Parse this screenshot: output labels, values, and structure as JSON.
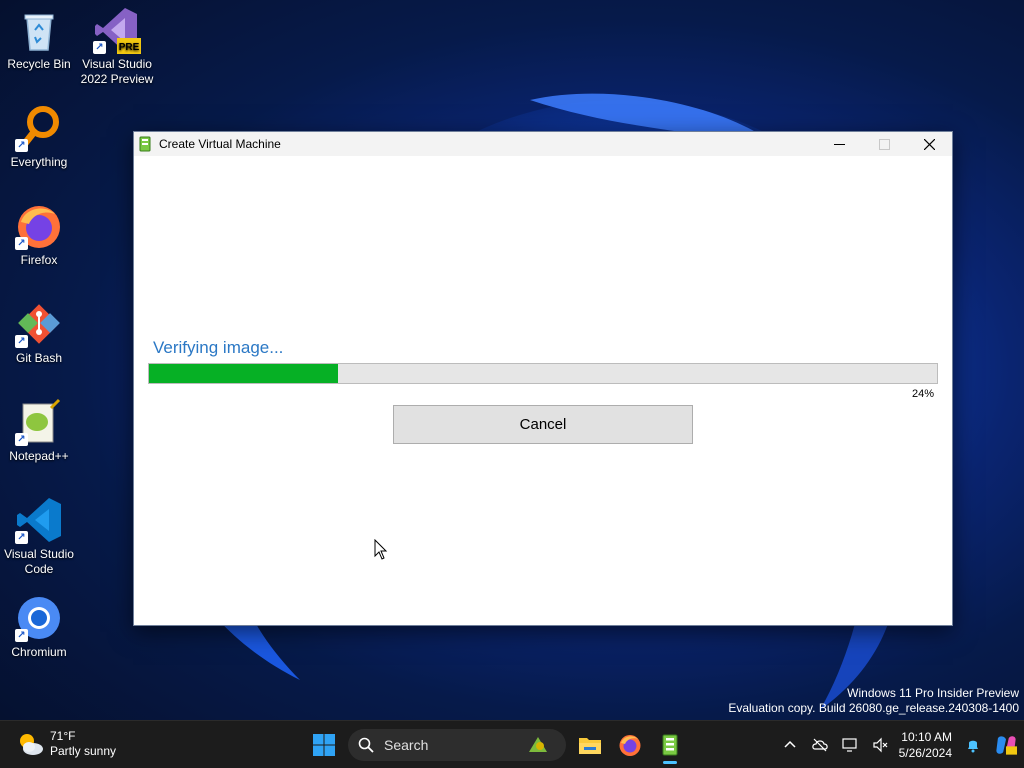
{
  "desktop": {
    "icons": [
      {
        "label": "Recycle Bin",
        "icon": "recycle-bin-icon"
      },
      {
        "label": "Visual Studio 2022 Preview",
        "icon": "visual-studio-icon",
        "badge": "PRE"
      },
      {
        "label": "Everything",
        "icon": "everything-search-icon"
      },
      {
        "label": "Firefox",
        "icon": "firefox-icon"
      },
      {
        "label": "Git Bash",
        "icon": "git-bash-icon"
      },
      {
        "label": "Notepad++",
        "icon": "notepad-plus-plus-icon"
      },
      {
        "label": "Visual Studio Code",
        "icon": "vscode-icon"
      },
      {
        "label": "Chromium",
        "icon": "chromium-icon"
      }
    ],
    "shortcut_arrow": "↗"
  },
  "window": {
    "title": "Create Virtual Machine",
    "status_text": "Verifying image...",
    "progress": 0.24,
    "percent_label": "24%",
    "cancel_label": "Cancel",
    "progress_color": "#06b025",
    "status_color": "#2b78c5"
  },
  "watermark": {
    "line1": "Windows 11 Pro Insider Preview",
    "line2": "Evaluation copy. Build 26080.ge_release.240308-1400"
  },
  "taskbar": {
    "weather_temp": "71°F",
    "weather_desc": "Partly sunny",
    "search_label": "Search",
    "apps": [
      "start-icon",
      "file-explorer-icon",
      "firefox-icon",
      "quickemu-icon"
    ],
    "clock_time": "10:10 AM",
    "clock_date": "5/26/2024",
    "accent": "#4cc2ff"
  }
}
